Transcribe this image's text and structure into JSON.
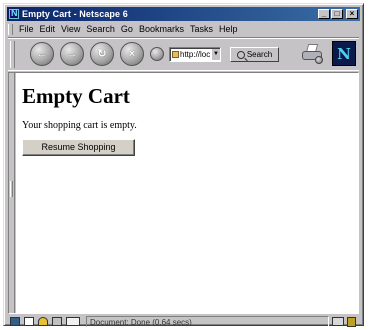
{
  "window": {
    "title": "Empty Cart - Netscape 6",
    "controls": [
      "_",
      "□",
      "×"
    ]
  },
  "menu": [
    "File",
    "Edit",
    "View",
    "Search",
    "Go",
    "Bookmarks",
    "Tasks",
    "Help"
  ],
  "toolbar": {
    "back_glyph": "←",
    "forward_glyph": "→",
    "reload_glyph": "↻",
    "stop_glyph": "×",
    "url_value": "http://loc",
    "search_label": "Search",
    "throbber_letter": "N"
  },
  "page": {
    "heading": "Empty Cart",
    "message": "Your shopping cart is empty.",
    "resume_button": "Resume Shopping"
  },
  "status": {
    "text": "Document: Done (0.64 secs)"
  },
  "colors": {
    "title_bar": "#0a246a",
    "chrome": "#c6c3c6",
    "page_bg": "#ffffff"
  }
}
